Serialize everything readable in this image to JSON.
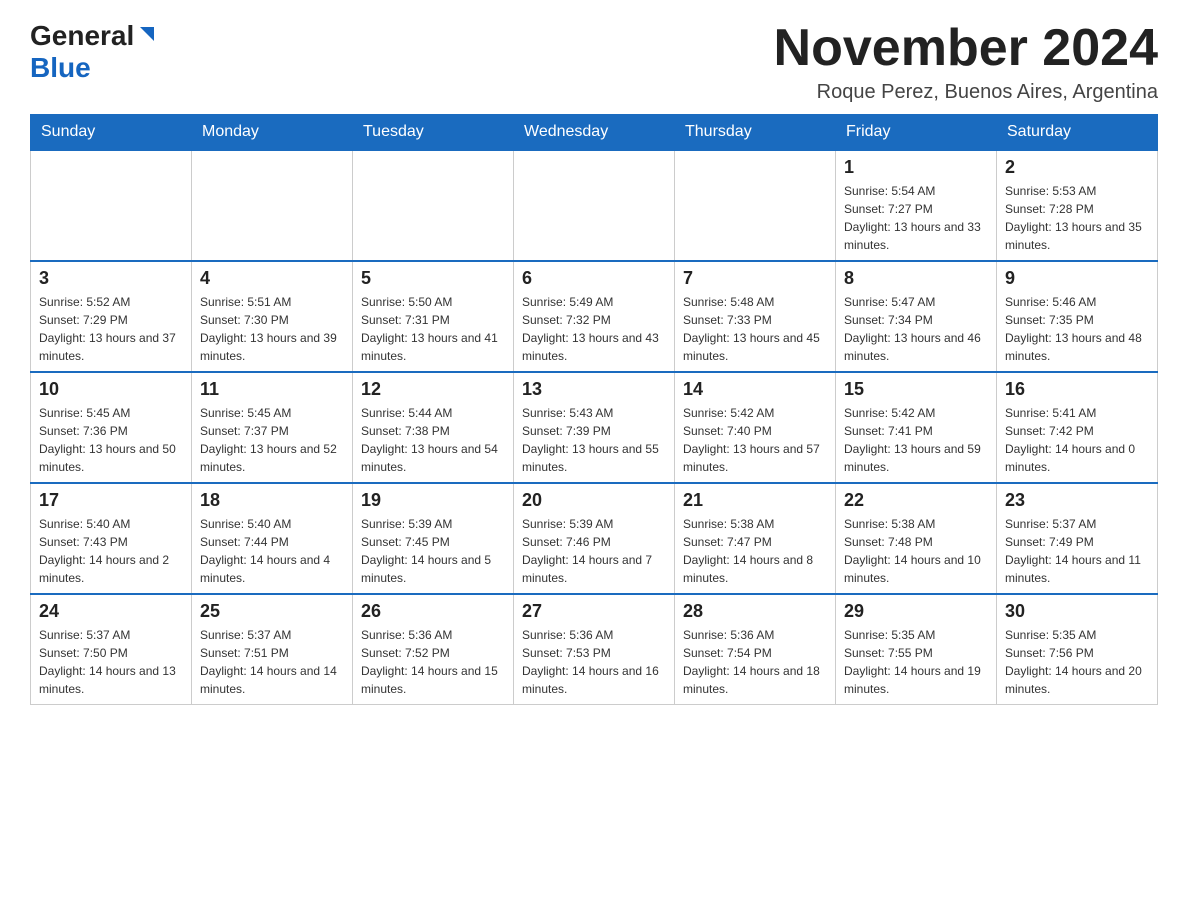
{
  "header": {
    "logo": {
      "general": "General",
      "blue": "Blue"
    },
    "title": "November 2024",
    "location": "Roque Perez, Buenos Aires, Argentina"
  },
  "weekdays": [
    "Sunday",
    "Monday",
    "Tuesday",
    "Wednesday",
    "Thursday",
    "Friday",
    "Saturday"
  ],
  "weeks": [
    [
      {
        "day": "",
        "info": ""
      },
      {
        "day": "",
        "info": ""
      },
      {
        "day": "",
        "info": ""
      },
      {
        "day": "",
        "info": ""
      },
      {
        "day": "",
        "info": ""
      },
      {
        "day": "1",
        "info": "Sunrise: 5:54 AM\nSunset: 7:27 PM\nDaylight: 13 hours and 33 minutes."
      },
      {
        "day": "2",
        "info": "Sunrise: 5:53 AM\nSunset: 7:28 PM\nDaylight: 13 hours and 35 minutes."
      }
    ],
    [
      {
        "day": "3",
        "info": "Sunrise: 5:52 AM\nSunset: 7:29 PM\nDaylight: 13 hours and 37 minutes."
      },
      {
        "day": "4",
        "info": "Sunrise: 5:51 AM\nSunset: 7:30 PM\nDaylight: 13 hours and 39 minutes."
      },
      {
        "day": "5",
        "info": "Sunrise: 5:50 AM\nSunset: 7:31 PM\nDaylight: 13 hours and 41 minutes."
      },
      {
        "day": "6",
        "info": "Sunrise: 5:49 AM\nSunset: 7:32 PM\nDaylight: 13 hours and 43 minutes."
      },
      {
        "day": "7",
        "info": "Sunrise: 5:48 AM\nSunset: 7:33 PM\nDaylight: 13 hours and 45 minutes."
      },
      {
        "day": "8",
        "info": "Sunrise: 5:47 AM\nSunset: 7:34 PM\nDaylight: 13 hours and 46 minutes."
      },
      {
        "day": "9",
        "info": "Sunrise: 5:46 AM\nSunset: 7:35 PM\nDaylight: 13 hours and 48 minutes."
      }
    ],
    [
      {
        "day": "10",
        "info": "Sunrise: 5:45 AM\nSunset: 7:36 PM\nDaylight: 13 hours and 50 minutes."
      },
      {
        "day": "11",
        "info": "Sunrise: 5:45 AM\nSunset: 7:37 PM\nDaylight: 13 hours and 52 minutes."
      },
      {
        "day": "12",
        "info": "Sunrise: 5:44 AM\nSunset: 7:38 PM\nDaylight: 13 hours and 54 minutes."
      },
      {
        "day": "13",
        "info": "Sunrise: 5:43 AM\nSunset: 7:39 PM\nDaylight: 13 hours and 55 minutes."
      },
      {
        "day": "14",
        "info": "Sunrise: 5:42 AM\nSunset: 7:40 PM\nDaylight: 13 hours and 57 minutes."
      },
      {
        "day": "15",
        "info": "Sunrise: 5:42 AM\nSunset: 7:41 PM\nDaylight: 13 hours and 59 minutes."
      },
      {
        "day": "16",
        "info": "Sunrise: 5:41 AM\nSunset: 7:42 PM\nDaylight: 14 hours and 0 minutes."
      }
    ],
    [
      {
        "day": "17",
        "info": "Sunrise: 5:40 AM\nSunset: 7:43 PM\nDaylight: 14 hours and 2 minutes."
      },
      {
        "day": "18",
        "info": "Sunrise: 5:40 AM\nSunset: 7:44 PM\nDaylight: 14 hours and 4 minutes."
      },
      {
        "day": "19",
        "info": "Sunrise: 5:39 AM\nSunset: 7:45 PM\nDaylight: 14 hours and 5 minutes."
      },
      {
        "day": "20",
        "info": "Sunrise: 5:39 AM\nSunset: 7:46 PM\nDaylight: 14 hours and 7 minutes."
      },
      {
        "day": "21",
        "info": "Sunrise: 5:38 AM\nSunset: 7:47 PM\nDaylight: 14 hours and 8 minutes."
      },
      {
        "day": "22",
        "info": "Sunrise: 5:38 AM\nSunset: 7:48 PM\nDaylight: 14 hours and 10 minutes."
      },
      {
        "day": "23",
        "info": "Sunrise: 5:37 AM\nSunset: 7:49 PM\nDaylight: 14 hours and 11 minutes."
      }
    ],
    [
      {
        "day": "24",
        "info": "Sunrise: 5:37 AM\nSunset: 7:50 PM\nDaylight: 14 hours and 13 minutes."
      },
      {
        "day": "25",
        "info": "Sunrise: 5:37 AM\nSunset: 7:51 PM\nDaylight: 14 hours and 14 minutes."
      },
      {
        "day": "26",
        "info": "Sunrise: 5:36 AM\nSunset: 7:52 PM\nDaylight: 14 hours and 15 minutes."
      },
      {
        "day": "27",
        "info": "Sunrise: 5:36 AM\nSunset: 7:53 PM\nDaylight: 14 hours and 16 minutes."
      },
      {
        "day": "28",
        "info": "Sunrise: 5:36 AM\nSunset: 7:54 PM\nDaylight: 14 hours and 18 minutes."
      },
      {
        "day": "29",
        "info": "Sunrise: 5:35 AM\nSunset: 7:55 PM\nDaylight: 14 hours and 19 minutes."
      },
      {
        "day": "30",
        "info": "Sunrise: 5:35 AM\nSunset: 7:56 PM\nDaylight: 14 hours and 20 minutes."
      }
    ]
  ]
}
